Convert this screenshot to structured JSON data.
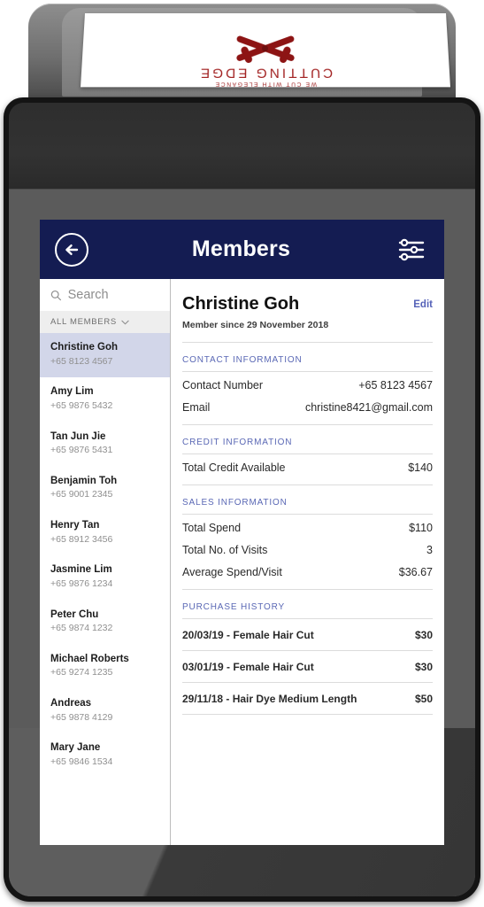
{
  "device": {
    "receipt": {
      "tagline": "WE CUT WITH ELEGANCE",
      "brand": "CUTTING EDGE",
      "logo_icon": "scissors-icon",
      "brand_color": "#a11f1f"
    }
  },
  "header": {
    "title": "Members",
    "back_icon": "back-arrow-icon",
    "filter_icon": "sliders-filter-icon",
    "background_color": "#141c52"
  },
  "sidebar": {
    "search": {
      "placeholder": "Search",
      "value": "",
      "icon": "search-icon"
    },
    "filter": {
      "label": "ALL MEMBERS",
      "chevron_icon": "chevron-down-icon"
    },
    "selected_index": 0,
    "selected_color": "#d2d6e9",
    "members": [
      {
        "name": "Christine Goh",
        "phone": "+65 8123 4567"
      },
      {
        "name": "Amy Lim",
        "phone": "+65 9876 5432"
      },
      {
        "name": "Tan Jun Jie",
        "phone": "+65 9876 5431"
      },
      {
        "name": "Benjamin Toh",
        "phone": "+65 9001 2345"
      },
      {
        "name": "Henry Tan",
        "phone": "+65 8912 3456"
      },
      {
        "name": "Jasmine Lim",
        "phone": "+65 9876 1234"
      },
      {
        "name": "Peter Chu",
        "phone": "+65 9874 1232"
      },
      {
        "name": "Michael Roberts",
        "phone": "+65 9274 1235"
      },
      {
        "name": "Andreas",
        "phone": "+65 9878 4129"
      },
      {
        "name": "Mary Jane",
        "phone": "+65 9846 1534"
      }
    ]
  },
  "detail": {
    "name": "Christine Goh",
    "member_since": "Member since 29 November 2018",
    "edit_label": "Edit",
    "accent_color": "#5a68b5",
    "sections": [
      {
        "title": "CONTACT INFORMATION",
        "rows": [
          {
            "key": "Contact Number",
            "value": "+65 8123 4567"
          },
          {
            "key": "Email",
            "value": "christine8421@gmail.com"
          }
        ]
      },
      {
        "title": "CREDIT INFORMATION",
        "rows": [
          {
            "key": "Total Credit Available",
            "value": "$140"
          }
        ]
      },
      {
        "title": "SALES INFORMATION",
        "rows": [
          {
            "key": "Total Spend",
            "value": "$110"
          },
          {
            "key": "Total No. of Visits",
            "value": "3"
          },
          {
            "key": "Average Spend/Visit",
            "value": "$36.67"
          }
        ]
      }
    ],
    "purchase_history": {
      "title": "PURCHASE HISTORY",
      "items": [
        {
          "label": "20/03/19 - Female Hair Cut",
          "amount": "$30"
        },
        {
          "label": "03/01/19 - Female Hair Cut",
          "amount": "$30"
        },
        {
          "label": "29/11/18 - Hair Dye Medium Length",
          "amount": "$50"
        }
      ]
    }
  }
}
